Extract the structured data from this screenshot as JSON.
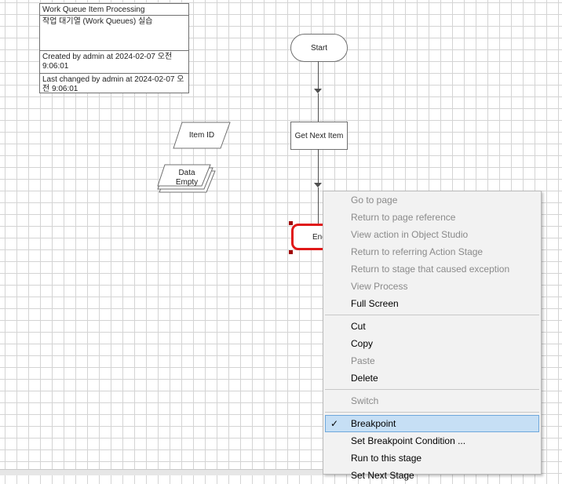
{
  "info": {
    "title": "Work Queue Item Processing",
    "description": "작업 대기열 (Work Queues) 실습",
    "created": "Created  by  admin  at  2024-02-07 오전 9:06:01",
    "changed": "Last changed by admin at 2024-02-07 오전 9:06:01"
  },
  "stages": {
    "start": "Start",
    "get_next_item": "Get Next Item",
    "end": "End",
    "item_id": "Item ID",
    "data_empty": "Data Empty"
  },
  "menu": {
    "items": [
      {
        "label": "Go to page",
        "enabled": false
      },
      {
        "label": "Return to page reference",
        "enabled": false
      },
      {
        "label": "View action in Object Studio",
        "enabled": false
      },
      {
        "label": "Return to referring Action Stage",
        "enabled": false
      },
      {
        "label": "Return to stage that caused exception",
        "enabled": false
      },
      {
        "label": "View Process",
        "enabled": false
      },
      {
        "label": "Full Screen",
        "enabled": true
      },
      {
        "label": "Cut",
        "enabled": true
      },
      {
        "label": "Copy",
        "enabled": true
      },
      {
        "label": "Paste",
        "enabled": false
      },
      {
        "label": "Delete",
        "enabled": true
      },
      {
        "label": "Switch",
        "enabled": false
      },
      {
        "label": "Breakpoint",
        "enabled": true,
        "checked": true
      },
      {
        "label": "Set Breakpoint Condition ...",
        "enabled": true
      },
      {
        "label": "Run to this stage",
        "enabled": true
      },
      {
        "label": "Set Next Stage",
        "enabled": true
      }
    ],
    "check_glyph": "✓"
  },
  "colors": {
    "selection_border": "#e01818",
    "menu_highlight": "#c6dff5"
  }
}
